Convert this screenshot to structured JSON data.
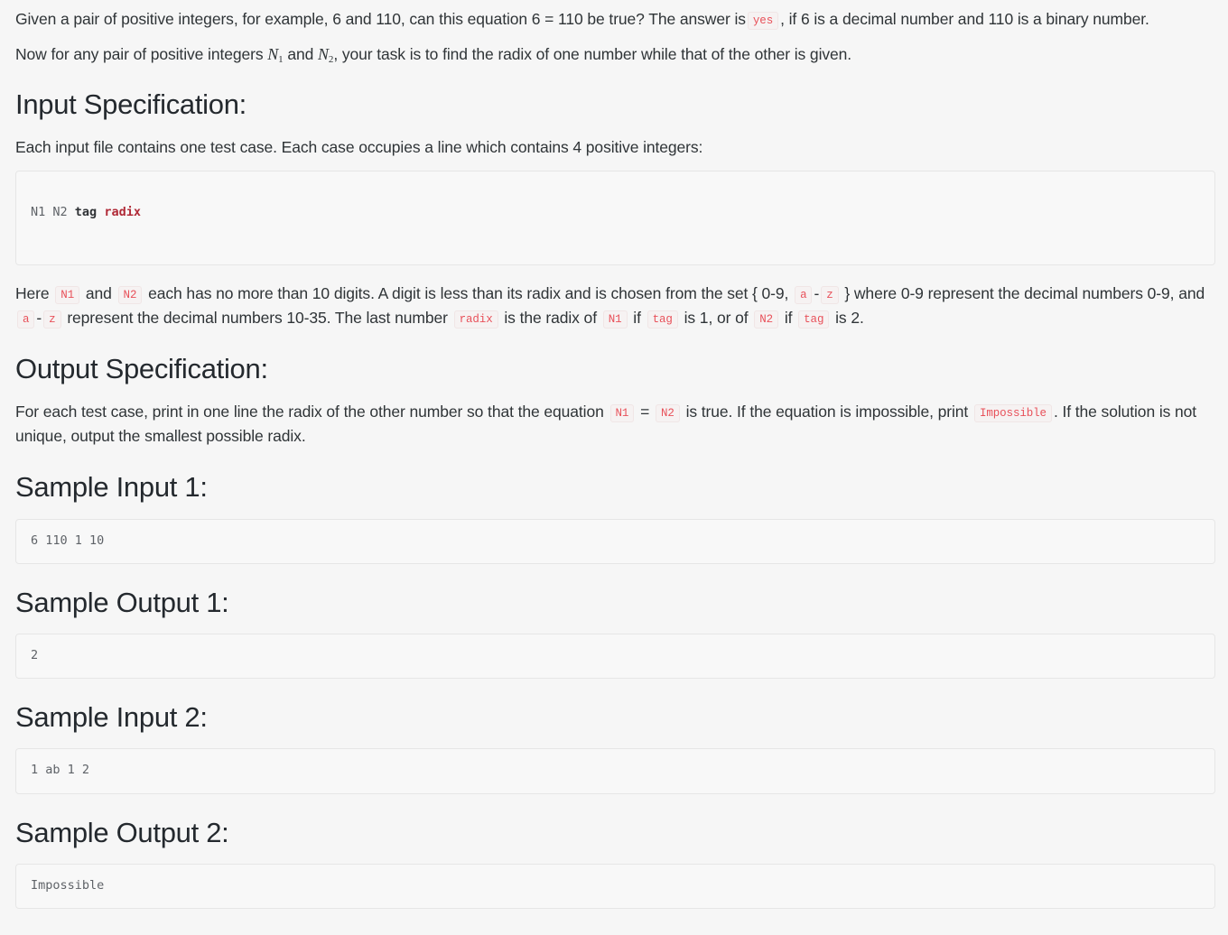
{
  "intro": {
    "line1_a": "Given a pair of positive integers, for example, 6 and 110, can this equation 6 = 110 be true? The answer is",
    "chip_yes": "yes",
    "line1_b": ", if 6 is a decimal number and 110 is a binary number.",
    "line2_a": "Now for any pair of positive integers",
    "math_n1": "N",
    "math_n1_sub": "1",
    "line2_and": "and",
    "math_n2": "N",
    "math_n2_sub": "2",
    "line2_b": ", your task is to find the radix of one number while that of the other is given."
  },
  "input_spec": {
    "heading": "Input Specification:",
    "paragraph": "Each input file contains one test case. Each case occupies a line which contains 4 positive integers:",
    "code_tokens": [
      {
        "text": "N1 N2 ",
        "style": "plain"
      },
      {
        "text": "tag",
        "style": "bold"
      },
      {
        "text": " ",
        "style": "plain"
      },
      {
        "text": "radix",
        "style": "key-r"
      }
    ],
    "note": {
      "t1": "Here",
      "c1": "N1",
      "t2": "and",
      "c2": "N2",
      "t3": "each has no more than 10 digits. A digit is less than its radix and is chosen from the set { 0-9,",
      "c3": "a",
      "t4": "-",
      "c4": "z",
      "t5": "} where 0-9 represent the decimal numbers 0-9, and",
      "c5": "a",
      "t6": "-",
      "c6": "z",
      "t7": "represent the decimal numbers 10-35. The last number",
      "c7": "radix",
      "t8": "is the radix of",
      "c8": "N1",
      "t9": "if",
      "c9": "tag",
      "t10": "is 1, or of",
      "c10": "N2",
      "t11": "if",
      "c11": "tag",
      "t12": "is 2."
    }
  },
  "output_spec": {
    "heading": "Output Specification:",
    "t1": "For each test case, print in one line the radix of the other number so that the equation",
    "c1": "N1",
    "eq": "=",
    "c2": "N2",
    "t2": "is true. If the equation is impossible, print",
    "c3": "Impossible",
    "t3": ". If the solution is not unique, output the smallest possible radix."
  },
  "samples": [
    {
      "heading": "Sample Input 1:",
      "code": "6 110 1 10"
    },
    {
      "heading": "Sample Output 1:",
      "code": "2"
    },
    {
      "heading": "Sample Input 2:",
      "code": "1 ab 1 2"
    },
    {
      "heading": "Sample Output 2:",
      "code": "Impossible"
    }
  ],
  "colors": {
    "page_background": "#f6f6f6",
    "code_background": "#f8f8f8",
    "code_border": "#e6e6e6",
    "inline_code_text": "#e8515a",
    "heading_text": "#24292e",
    "body_text": "#2f3437"
  }
}
